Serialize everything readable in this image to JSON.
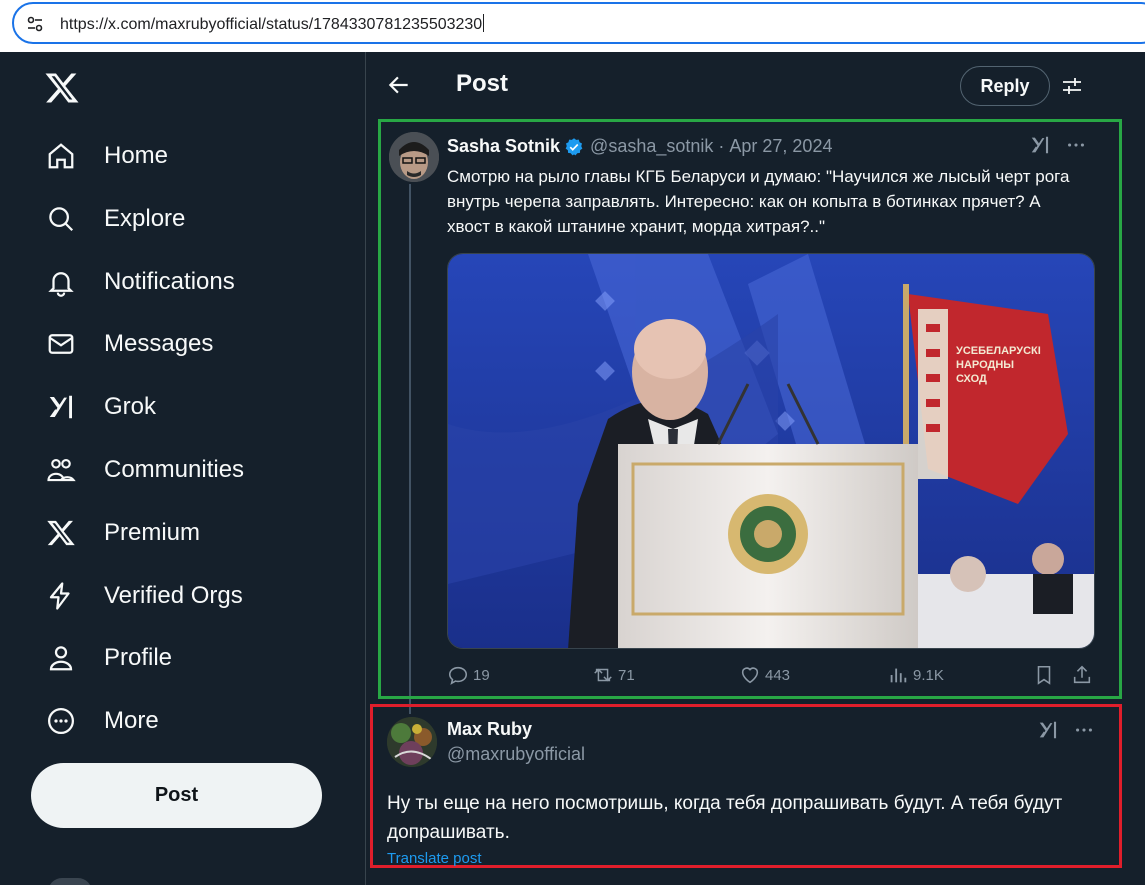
{
  "browser": {
    "url": "https://x.com/maxrubyofficial/status/1784330781235503230"
  },
  "sidebar": {
    "items": [
      {
        "label": "Home",
        "icon": "home-icon"
      },
      {
        "label": "Explore",
        "icon": "search-icon"
      },
      {
        "label": "Notifications",
        "icon": "bell-icon"
      },
      {
        "label": "Messages",
        "icon": "envelope-icon"
      },
      {
        "label": "Grok",
        "icon": "grok-icon"
      },
      {
        "label": "Communities",
        "icon": "people-icon"
      },
      {
        "label": "Premium",
        "icon": "x-logo-icon"
      },
      {
        "label": "Verified Orgs",
        "icon": "lightning-icon"
      },
      {
        "label": "Profile",
        "icon": "person-icon"
      },
      {
        "label": "More",
        "icon": "more-circle-icon"
      }
    ],
    "post_button": "Post"
  },
  "header": {
    "title": "Post",
    "reply_button": "Reply"
  },
  "tweet1": {
    "author_name": "Sasha Sotnik",
    "handle": "@sasha_sotnik",
    "separator": "·",
    "date": "Apr 27, 2024",
    "text": "Смотрю на рыло главы КГБ Беларуси и думаю: \"Научился же лысый черт рога внутрь черепа заправлять. Интересно: как он копыта в ботинках прячет? А хвост в какой штанине хранит, морда хитрая?..\"",
    "image_banner_text": "УСЕБЕЛАРУСКІ НАРОДНЫ СХОД",
    "counts": {
      "replies": "19",
      "reposts": "71",
      "likes": "443",
      "views": "9.1K"
    }
  },
  "tweet2": {
    "author_name": "Max Ruby",
    "handle": "@maxrubyofficial",
    "text": "Ну ты еще на него посмотришь, когда тебя допрашивать будут. А тебя будут допрашивать.",
    "translate_link": "Translate post"
  },
  "colors": {
    "background": "#15202b",
    "highlight_green": "#28a745",
    "highlight_red": "#e01e2b",
    "link_blue": "#1d9bf0",
    "muted_text": "#8b98a5"
  }
}
